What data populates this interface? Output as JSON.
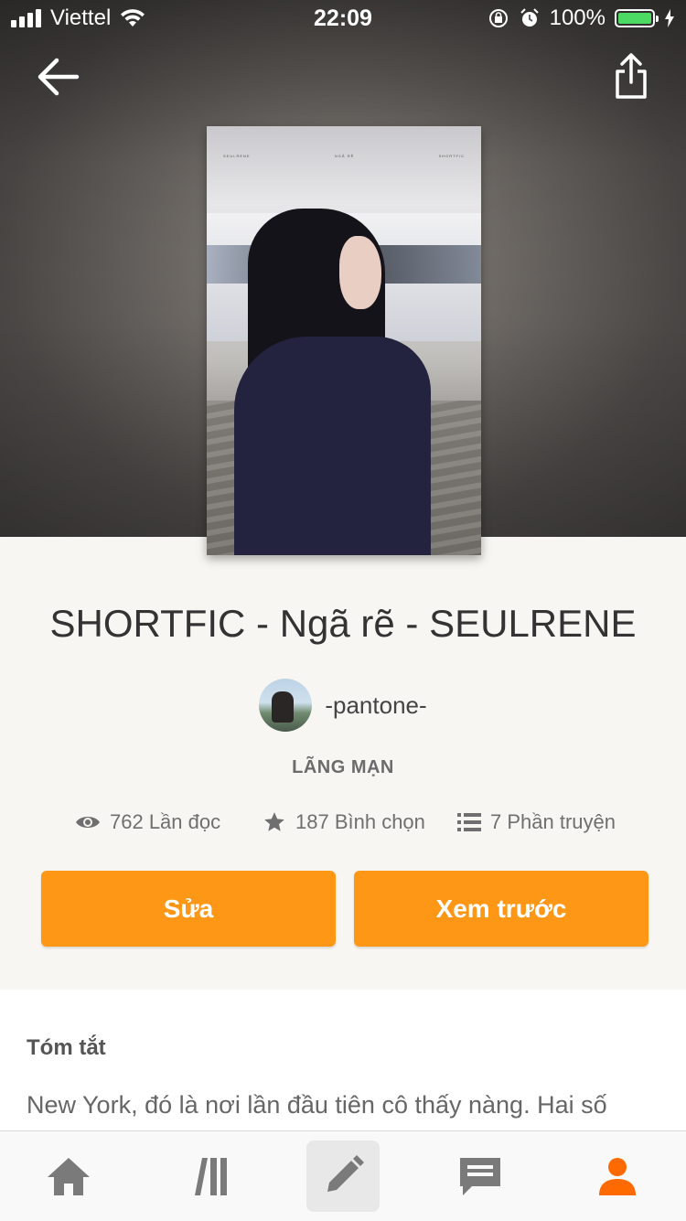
{
  "status_bar": {
    "carrier": "Viettel",
    "time": "22:09",
    "battery": "100%"
  },
  "cover_caption": {
    "left": "SEULRENE",
    "center": "NGÃ RẼ",
    "right": "SHORTFIC"
  },
  "story": {
    "title": "SHORTFIC - Ngã rẽ - SEULRENE",
    "author": "-pantone-",
    "genre": "LÃNG MẠN"
  },
  "stats": {
    "reads": "762 Lần đọc",
    "votes": "187 Bình chọn",
    "parts": "7 Phần truyện"
  },
  "actions": {
    "edit": "Sửa",
    "preview": "Xem trước"
  },
  "summary": {
    "heading": "Tóm tắt",
    "text": "New York, đó là nơi lần đầu tiên cô thấy nàng. Hai số"
  },
  "tabbar": {
    "items": [
      "home-icon",
      "library-icon",
      "write-icon",
      "messages-icon",
      "profile-icon"
    ],
    "active_color": "#ff6a00",
    "inactive_color": "#7a7a7a"
  },
  "colors": {
    "accent": "#ff9716",
    "battery": "#4cd964"
  }
}
